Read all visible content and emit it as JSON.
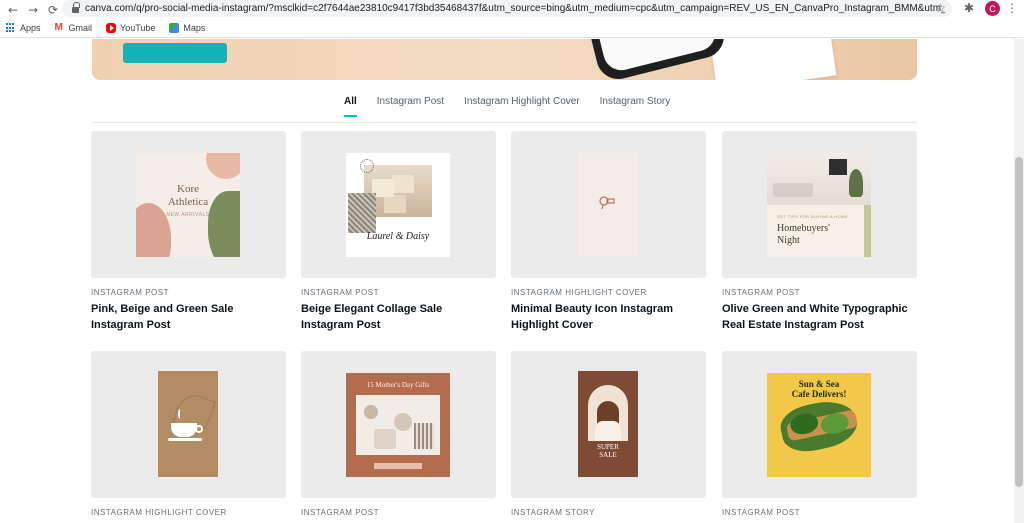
{
  "browser": {
    "url": "canva.com/q/pro-social-media-instagram/?msclkid=c2f7644ae23810c9417f3bd35468437f&utm_source=bing&utm_medium=cpc&utm_campaign=REV_US_EN_CanvaPro_Instagram_BMM&utm_term=%2Binstag...",
    "profile_initial": "C",
    "bookmarks": [
      {
        "label": "Apps",
        "icon": "apps-icon"
      },
      {
        "label": "Gmail",
        "icon": "gmail-icon"
      },
      {
        "label": "YouTube",
        "icon": "youtube-icon"
      },
      {
        "label": "Maps",
        "icon": "maps-icon"
      }
    ]
  },
  "tabs": [
    {
      "label": "All",
      "active": true
    },
    {
      "label": "Instagram Post",
      "active": false
    },
    {
      "label": "Instagram Highlight Cover",
      "active": false
    },
    {
      "label": "Instagram Story",
      "active": false
    }
  ],
  "templates": [
    {
      "kind": "INSTAGRAM POST",
      "title": "Pink, Beige and Green Sale Instagram Post",
      "preview": {
        "line1": "Kore",
        "line2": "Athletica",
        "line3": "NEW ARRIVALS"
      }
    },
    {
      "kind": "INSTAGRAM POST",
      "title": "Beige Elegant Collage Sale Instagram Post",
      "preview": {
        "line1": "Laurel & Daisy"
      }
    },
    {
      "kind": "INSTAGRAM HIGHLIGHT COVER",
      "title": "Minimal Beauty Icon Instagram Highlight Cover",
      "preview": {}
    },
    {
      "kind": "INSTAGRAM POST",
      "title": "Olive Green and White Typographic Real Estate Instagram Post",
      "preview": {
        "line1": "GET TIPS FOR BUYING A HOME",
        "line2": "Homebuyers'",
        "line3": "Night"
      }
    },
    {
      "kind": "INSTAGRAM HIGHLIGHT COVER",
      "title": "",
      "preview": {}
    },
    {
      "kind": "INSTAGRAM POST",
      "title": "",
      "preview": {
        "line1": "15 Mother's Day Gifts"
      }
    },
    {
      "kind": "INSTAGRAM STORY",
      "title": "",
      "preview": {
        "line1": "SUPER",
        "line2": "SALE"
      }
    },
    {
      "kind": "INSTAGRAM POST",
      "title": "",
      "preview": {
        "line1": "Sun & Sea",
        "line2": "Cafe Delivers!"
      }
    }
  ],
  "colors": {
    "accent": "#00c4cc",
    "hero_button": "#17b2b8",
    "card_bg": "#ebebeb"
  }
}
